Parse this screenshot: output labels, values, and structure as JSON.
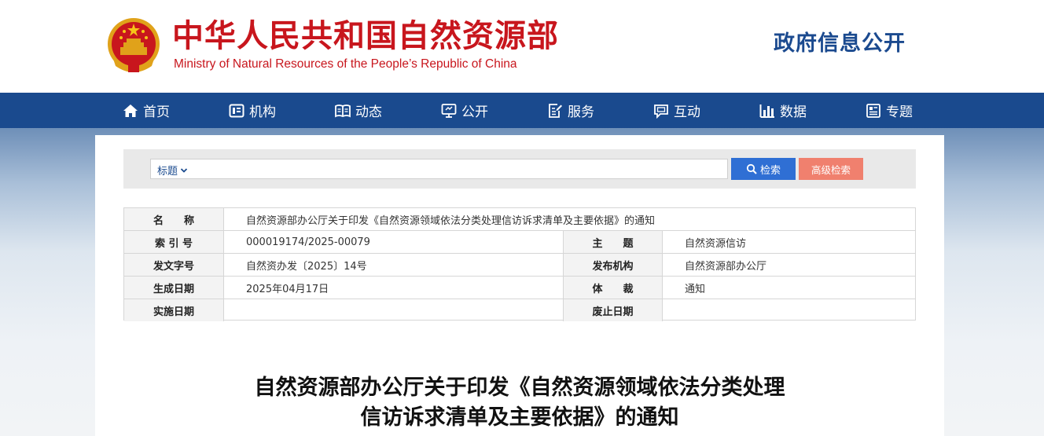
{
  "header": {
    "site_title_cn": "中华人民共和国自然资源部",
    "site_title_en": "Ministry of Natural Resources of the People’s Republic of China",
    "section_title": "政府信息公开",
    "brand_color": "#c8161d"
  },
  "nav": {
    "items": [
      {
        "label": "首页",
        "icon": "home-icon"
      },
      {
        "label": "机构",
        "icon": "org-icon"
      },
      {
        "label": "动态",
        "icon": "book-icon"
      },
      {
        "label": "公开",
        "icon": "monitor-icon"
      },
      {
        "label": "服务",
        "icon": "edit-doc-icon"
      },
      {
        "label": "互动",
        "icon": "chat-icon"
      },
      {
        "label": "数据",
        "icon": "bar-chart-icon"
      },
      {
        "label": "专题",
        "icon": "list-doc-icon"
      }
    ],
    "color": "#1a4a8e"
  },
  "search": {
    "field_select": "标题",
    "query": "",
    "search_label": "检索",
    "advanced_label": "高级检索"
  },
  "meta": {
    "name_label": "名　　称",
    "name_value": "自然资源部办公厅关于印发《自然资源领域依法分类处理信访诉求清单及主要依据》的通知",
    "index_label": "索 引 号",
    "index_value": "000019174/2025-00079",
    "topic_label": "主　　题",
    "topic_value": "自然资源信访",
    "docno_label": "发文字号",
    "docno_value": "自然资办发〔2025〕14号",
    "issuer_label": "发布机构",
    "issuer_value": "自然资源部办公厅",
    "created_label": "生成日期",
    "created_value": "2025年04月17日",
    "genre_label": "体　　裁",
    "genre_value": "通知",
    "effective_label": "实施日期",
    "effective_value": "",
    "expiry_label": "废止日期",
    "expiry_value": ""
  },
  "article": {
    "title_line1": "自然资源部办公厅关于印发《自然资源领域依法分类处理",
    "title_line2": "信访诉求清单及主要依据》的通知"
  }
}
